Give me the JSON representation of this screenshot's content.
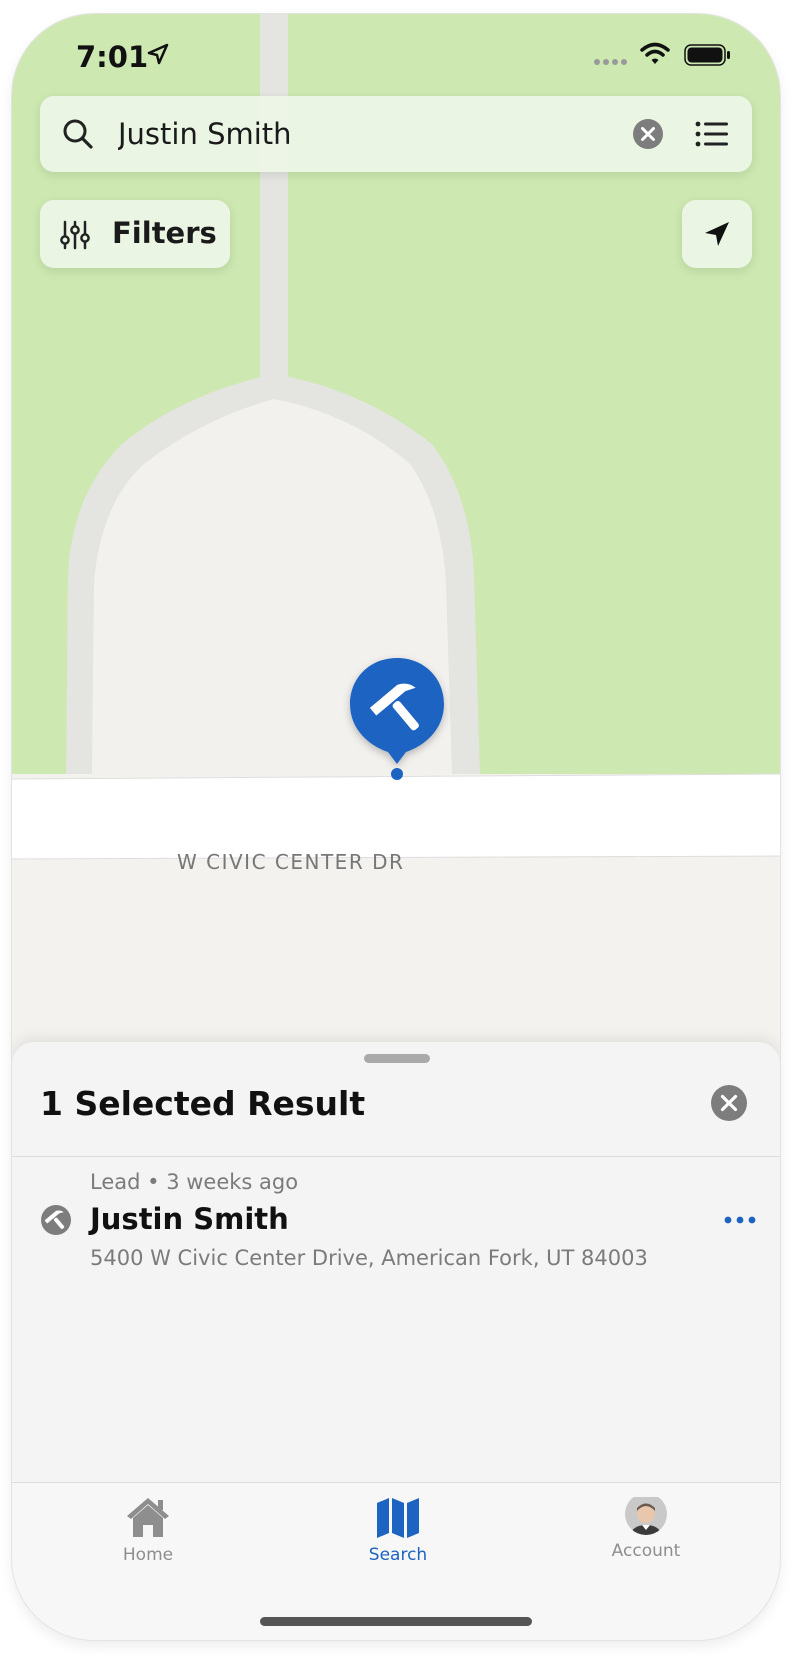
{
  "status_bar": {
    "time": "7:01"
  },
  "search": {
    "value": "Justin Smith",
    "icon": "magnifying-glass-icon",
    "clear_icon": "clear-circle-icon",
    "list_icon": "list-bullets-icon"
  },
  "filters": {
    "label": "Filters",
    "icon": "sliders-icon"
  },
  "locate": {
    "icon": "location-arrow-icon"
  },
  "map": {
    "street_label": "W CIVIC CENTER DR",
    "pin_icon": "hammer-icon",
    "colors": {
      "park": "#cde8b1",
      "road": "#e6e6e2",
      "lot": "#f2f1ee",
      "street": "#ffffff",
      "pin": "#1d63c2"
    }
  },
  "sheet": {
    "title": "1 Selected Result",
    "results": [
      {
        "type": "Lead",
        "separator": "•",
        "age": "3 weeks ago",
        "name": "Justin Smith",
        "address": "5400 W Civic Center Drive, American Fork, UT 84003",
        "icon": "hammer-circle-icon"
      }
    ]
  },
  "tabs": [
    {
      "label": "Home",
      "icon": "house-icon",
      "active": false
    },
    {
      "label": "Search",
      "icon": "map-icon",
      "active": true
    },
    {
      "label": "Account",
      "icon": "avatar-photo",
      "active": false
    }
  ],
  "colors": {
    "accent": "#1d63c2",
    "tab_inactive": "#8e8e8e"
  }
}
